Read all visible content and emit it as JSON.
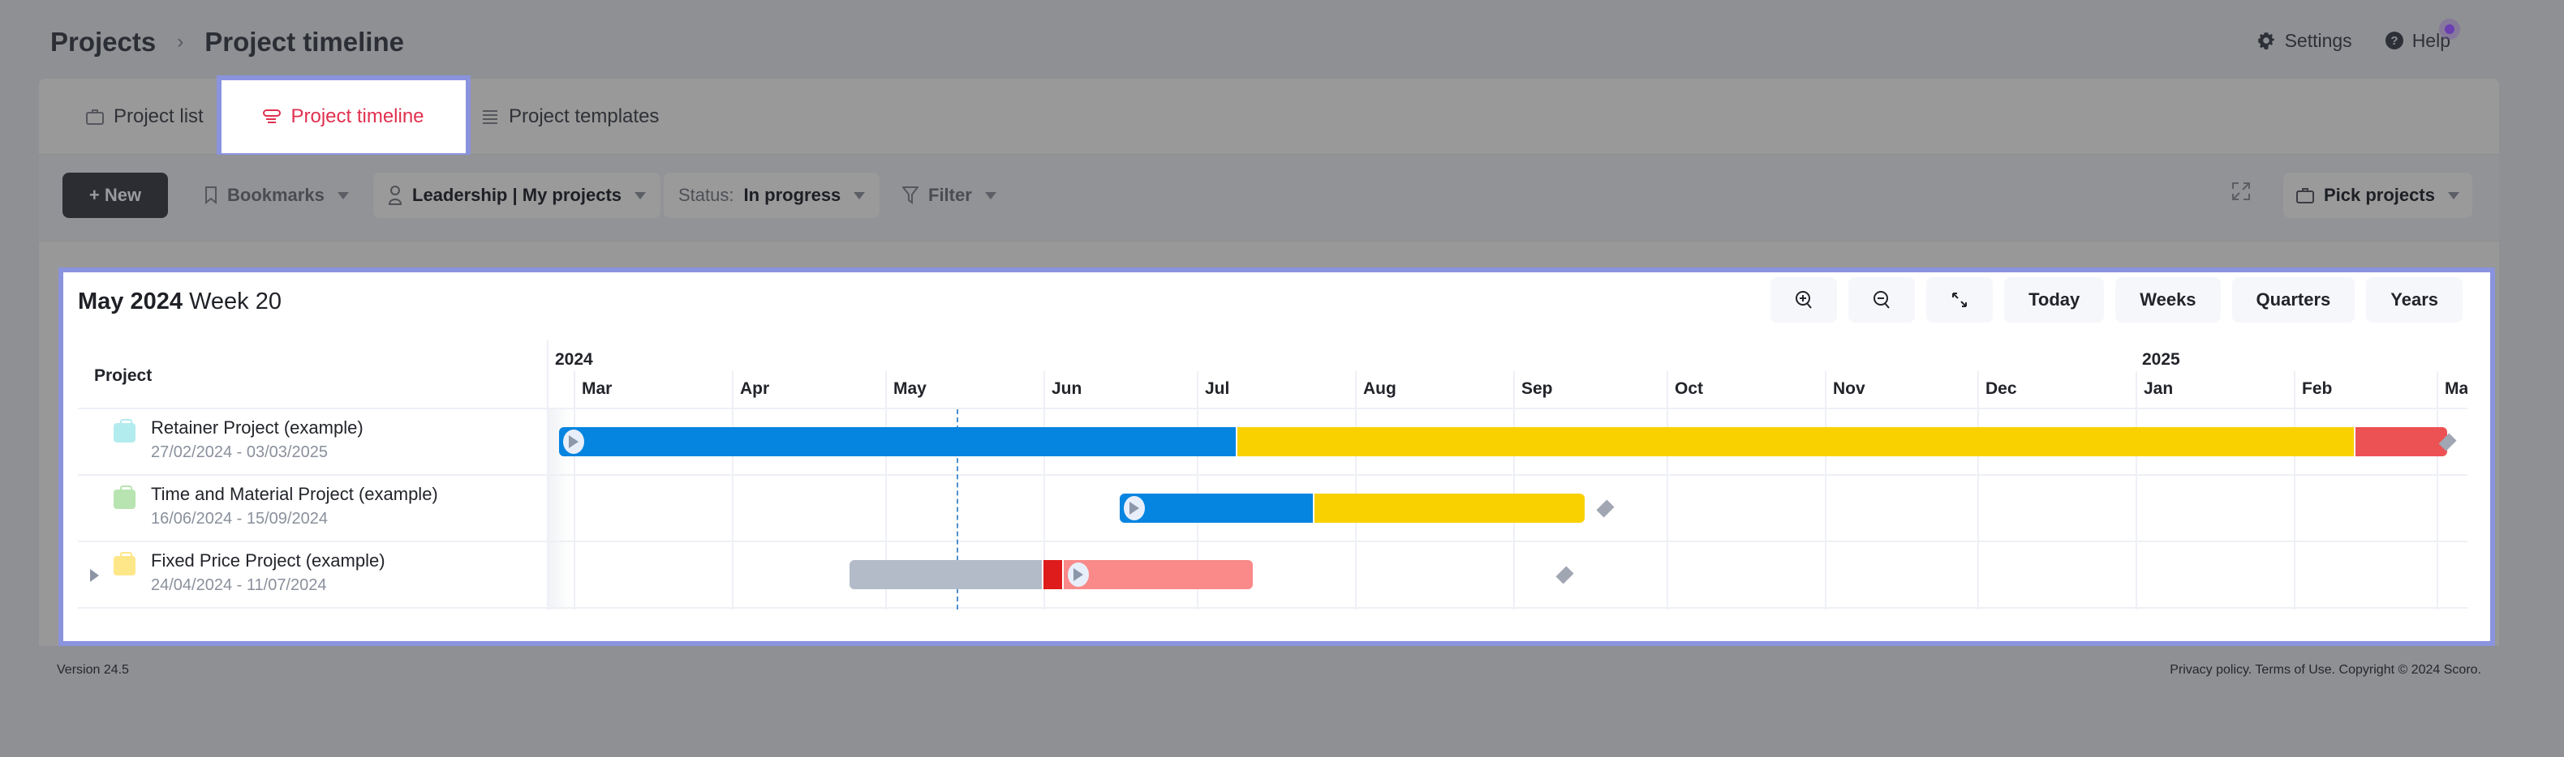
{
  "breadcrumb": {
    "root": "Projects",
    "separator": "›",
    "current": "Project timeline"
  },
  "top_links": {
    "settings": "Settings",
    "help": "Help"
  },
  "tabs": [
    {
      "label": "Project list",
      "icon": "briefcase-icon",
      "active": false
    },
    {
      "label": "Project timeline",
      "icon": "timeline-icon",
      "active": true
    },
    {
      "label": "Project templates",
      "icon": "list-icon",
      "active": false
    }
  ],
  "toolbar": {
    "new_label": "+ New",
    "bookmarks_label": "Bookmarks",
    "view_label": "Leadership | My projects",
    "status_prefix": "Status:",
    "status_value": "In progress",
    "filter_label": "Filter",
    "pick_projects_label": "Pick projects"
  },
  "panel": {
    "title_bold": "May 2024",
    "title_rest": "Week 20",
    "view_buttons": [
      "Today",
      "Weeks",
      "Quarters",
      "Years"
    ],
    "project_header": "Project"
  },
  "timeline": {
    "start_date": "2024-02-25",
    "today": "2024-05-15",
    "years": [
      {
        "label": "2024",
        "date": "2024-02-25"
      },
      {
        "label": "2025",
        "date": "2025-01-01"
      }
    ],
    "months": [
      {
        "label": "Mar",
        "date": "2024-03-01"
      },
      {
        "label": "Apr",
        "date": "2024-04-01"
      },
      {
        "label": "May",
        "date": "2024-05-01"
      },
      {
        "label": "Jun",
        "date": "2024-06-01"
      },
      {
        "label": "Jul",
        "date": "2024-07-01"
      },
      {
        "label": "Aug",
        "date": "2024-08-01"
      },
      {
        "label": "Sep",
        "date": "2024-09-01"
      },
      {
        "label": "Oct",
        "date": "2024-10-01"
      },
      {
        "label": "Nov",
        "date": "2024-11-01"
      },
      {
        "label": "Dec",
        "date": "2024-12-01"
      },
      {
        "label": "Jan",
        "date": "2025-01-01"
      },
      {
        "label": "Feb",
        "date": "2025-02-01"
      },
      {
        "label": "Mar",
        "date": "2025-03-01"
      }
    ]
  },
  "projects": [
    {
      "name": "Retainer Project (example)",
      "dates": "27/02/2024 - 03/03/2025",
      "color": "#b3ecee",
      "expandable": false,
      "segments": [
        {
          "from": "2024-02-27",
          "to": "2024-07-09",
          "color": "#0584e0"
        },
        {
          "from": "2024-07-09",
          "to": "2025-02-13",
          "color": "#f9d100"
        },
        {
          "from": "2025-02-13",
          "to": "2025-03-03",
          "color": "#ec5253"
        }
      ],
      "start_knob": true,
      "milestone": "2025-03-03"
    },
    {
      "name": "Time and Material Project (example)",
      "dates": "16/06/2024 - 15/09/2024",
      "color": "#b7e4b0",
      "expandable": false,
      "segments": [
        {
          "from": "2024-06-16",
          "to": "2024-07-24",
          "color": "#0584e0"
        },
        {
          "from": "2024-07-24",
          "to": "2024-09-15",
          "color": "#f9d100"
        }
      ],
      "start_knob": true,
      "milestone": "2024-09-19"
    },
    {
      "name": "Fixed Price Project (example)",
      "dates": "24/04/2024 - 11/07/2024",
      "color": "#fee789",
      "expandable": true,
      "segments": [
        {
          "from": "2024-04-24",
          "to": "2024-06-01",
          "color": "#b3bbc9"
        },
        {
          "from": "2024-06-01",
          "to": "2024-06-05",
          "color": "#dd1c1b"
        },
        {
          "from": "2024-06-05",
          "to": "2024-07-12",
          "color": "#f98a89"
        }
      ],
      "start_knob_at": "2024-06-05",
      "milestone": "2024-09-11"
    }
  ],
  "footer": {
    "version": "Version 24.5",
    "legal": "Privacy policy. Terms of Use. Copyright © 2024 Scoro."
  }
}
